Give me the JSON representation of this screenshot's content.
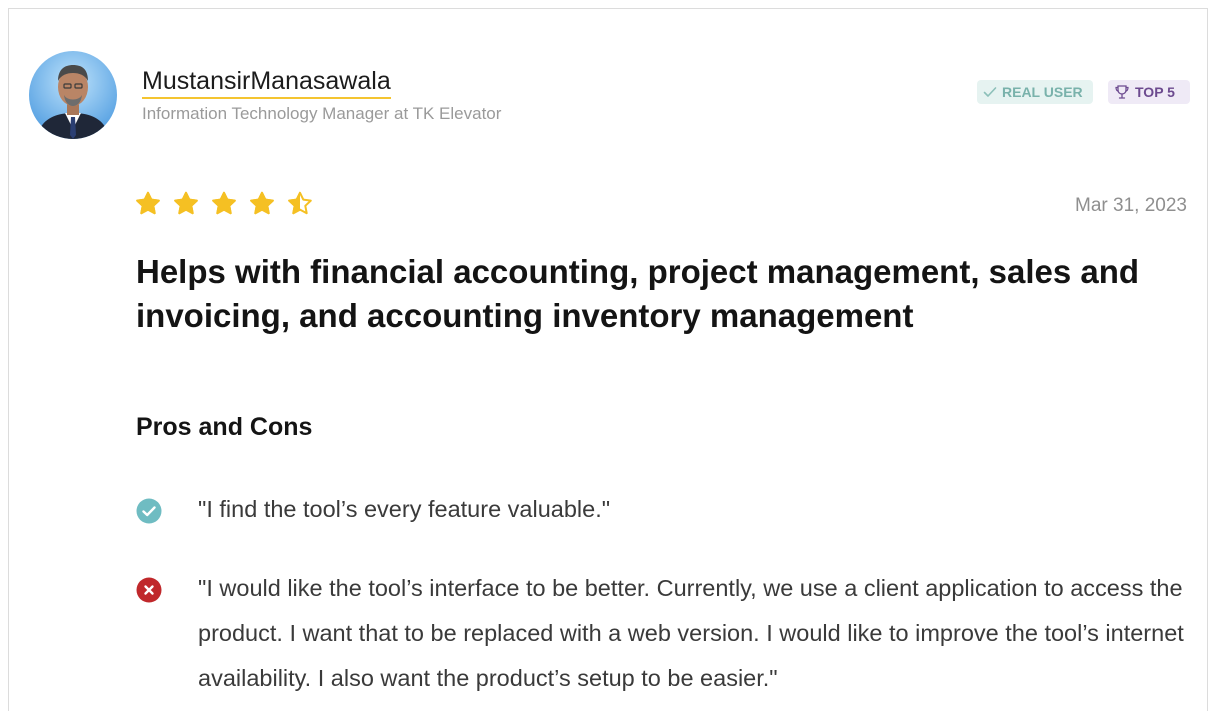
{
  "reviewer": {
    "name": "MustansirManasawala",
    "title": "Information Technology Manager at TK Elevator",
    "avatar": "reviewer-avatar-photo"
  },
  "badges": {
    "real_user": "REAL USER",
    "top": "TOP 5",
    "real_user_icon": "checkmark-icon",
    "top_icon": "trophy-icon"
  },
  "review": {
    "rating": 4.5,
    "rating_max": 5,
    "date": "Mar 31, 2023",
    "headline": "Helps with financial accounting, project management, sales and invoicing, and accounting inventory management"
  },
  "pros_cons": {
    "section_title": "Pros and Cons",
    "pros": [
      "\"I find the tool’s every feature valuable.\""
    ],
    "cons": [
      "\"I would like the tool’s interface to be better. Currently, we use a client application to access the product. I want that to be replaced with a web version. I would like to improve the tool’s internet availability. I also want the product’s setup to be easier.\""
    ]
  },
  "colors": {
    "star": "#f5c023",
    "name_underline": "#f4c430",
    "pro_icon": "#6fbcc2",
    "con_icon": "#c0282b",
    "real_user_bg": "#e6f3f1",
    "real_user_text": "#79b2ab",
    "top_bg": "#efeaf6",
    "top_text": "#6c4a8f"
  }
}
